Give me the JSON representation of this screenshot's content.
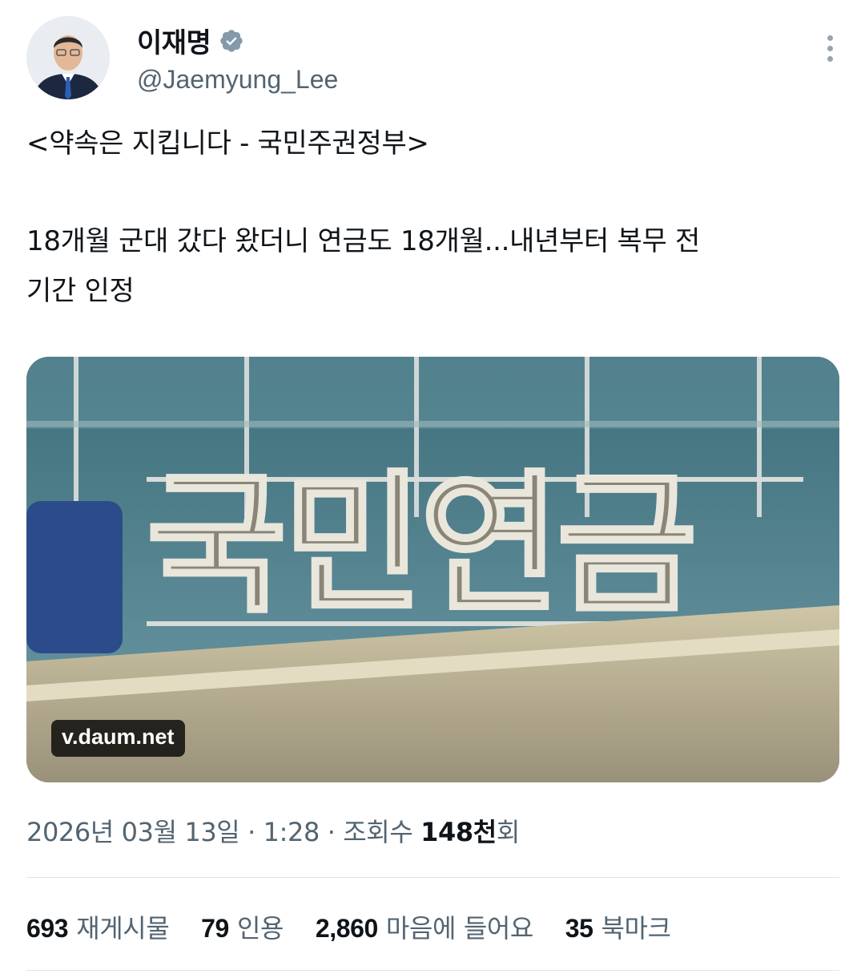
{
  "author": {
    "display_name": "이재명",
    "handle": "@Jaemyung_Lee",
    "verified_icon": "verified-badge-icon"
  },
  "tweet": {
    "line1": "<약속은 지킵니다 - 국민주권정부>",
    "line2": "18개월 군대 갔다 왔더니 연금도 18개월...내년부터 복무 전",
    "line3": "기간 인정"
  },
  "media": {
    "source_domain": "v.daum.net",
    "sign_text": "국민연금"
  },
  "meta": {
    "date": "2026년 03월 13일",
    "time": "1:28",
    "views_label": "조회수",
    "views_value": "148천",
    "views_suffix": "회"
  },
  "stats": {
    "retweets_count": "693",
    "retweets_label": "재게시물",
    "quotes_count": "79",
    "quotes_label": "인용",
    "likes_count": "2,860",
    "likes_label": "마음에 들어요",
    "bookmarks_count": "35",
    "bookmarks_label": "북마크"
  },
  "colors": {
    "text_primary": "#0f1419",
    "text_secondary": "#536471",
    "divider": "#e1e6ea"
  }
}
